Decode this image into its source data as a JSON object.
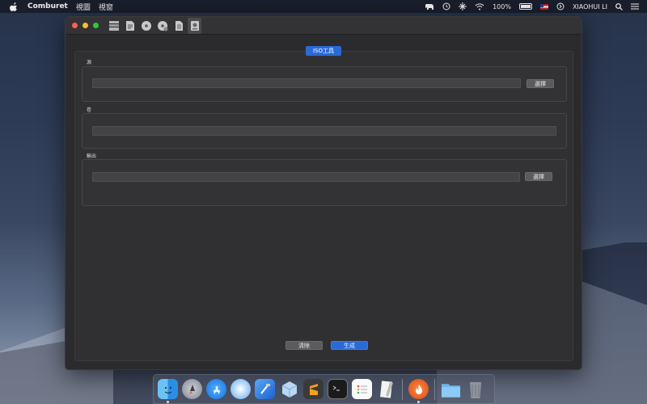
{
  "menubar": {
    "app_name": "Comburet",
    "menus": [
      "視圖",
      "視窗"
    ],
    "battery": "100%",
    "user": "XIAOHUI LI"
  },
  "toolbar": {
    "icons": [
      "shelf-icon",
      "file-edit-icon",
      "disc-icon",
      "disc-add-icon",
      "document-icon",
      "disk-image-icon"
    ]
  },
  "panel": {
    "tab_label": "ISO工具",
    "source": {
      "label": "源",
      "value": "",
      "choose_label": "選擇"
    },
    "volume": {
      "label": "卷",
      "value": ""
    },
    "output": {
      "label": "輸出",
      "value": "",
      "choose_label": "選擇"
    },
    "clear_label": "清除",
    "generate_label": "生成"
  },
  "dock": {
    "apps": [
      "Finder",
      "Launchpad",
      "App Store",
      "Safari",
      "Xcode",
      "Box",
      "Sublime Text",
      "Terminal",
      "Reminders",
      "TextEdit",
      "Comburet",
      "Downloads",
      "Trash"
    ]
  },
  "colors": {
    "accent": "#2a6ad8",
    "window_bg": "#2b2b2e"
  }
}
